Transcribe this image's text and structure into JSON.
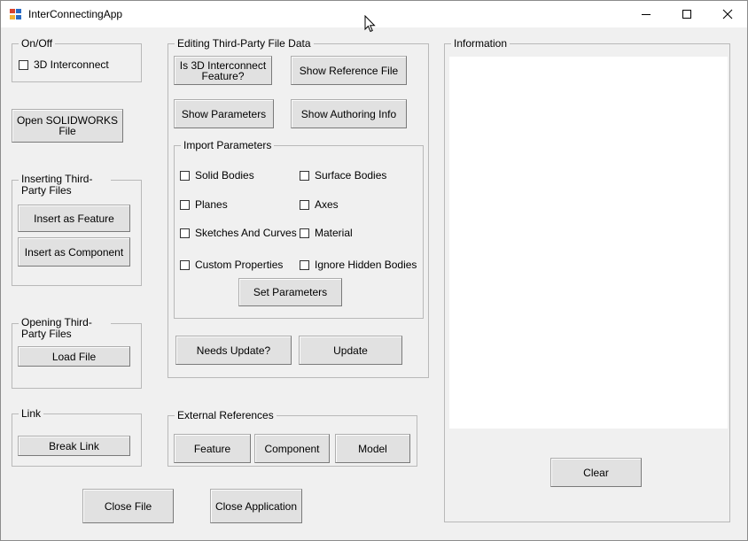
{
  "window": {
    "title": "InterConnectingApp"
  },
  "onoff": {
    "legend": "On/Off",
    "checkbox_label": "3D Interconnect"
  },
  "open_solidworks_label": "Open SOLIDWORKS File",
  "inserting": {
    "legend": "Inserting Third-Party Files",
    "insert_feature_label": "Insert as Feature",
    "insert_component_label": "Insert as Component"
  },
  "opening": {
    "legend": "Opening Third-Party Files",
    "load_file_label": "Load File"
  },
  "link": {
    "legend": "Link",
    "break_link_label": "Break Link"
  },
  "close_file_label": "Close File",
  "close_application_label": "Close Application",
  "editing": {
    "legend": "Editing Third-Party File Data",
    "is_3d_feature_label": "Is 3D Interconnect Feature?",
    "show_reference_label": "Show Reference File",
    "show_parameters_label": "Show Parameters",
    "show_authoring_label": "Show Authoring Info",
    "needs_update_label": "Needs Update?",
    "update_label": "Update"
  },
  "import": {
    "legend": "Import Parameters",
    "solid_bodies": "Solid Bodies",
    "surface_bodies": "Surface Bodies",
    "planes": "Planes",
    "axes": "Axes",
    "sketches_curves": "Sketches And Curves",
    "material": "Material",
    "custom_properties": "Custom Properties",
    "ignore_hidden_bodies": "Ignore Hidden Bodies",
    "set_parameters_label": "Set Parameters"
  },
  "external": {
    "legend": "External References",
    "feature_label": "Feature",
    "component_label": "Component",
    "model_label": "Model"
  },
  "information": {
    "legend": "Information",
    "clear_label": "Clear"
  },
  "icons": [
    "app-icon",
    "minimize-icon",
    "maximize-icon",
    "close-icon",
    "mouse-cursor-icon"
  ]
}
